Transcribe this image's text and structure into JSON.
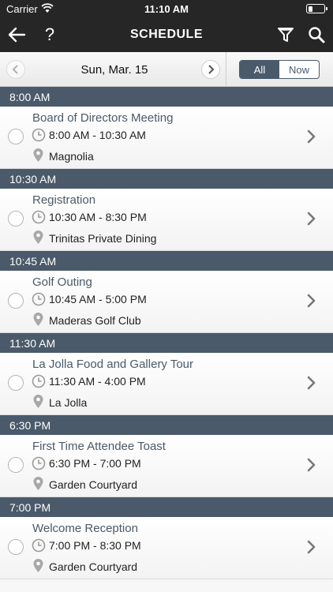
{
  "status_bar": {
    "carrier": "Carrier",
    "time": "11:10 AM"
  },
  "nav": {
    "title": "SCHEDULE",
    "help_label": "?"
  },
  "date_bar": {
    "date": "Sun, Mar. 15",
    "segments": [
      "All",
      "Now"
    ],
    "selected_segment": "All"
  },
  "colors": {
    "header_bg": "#262626",
    "section_bg": "#4a5a6a",
    "accent": "#4a5a6a"
  },
  "sections": [
    {
      "time": "8:00 AM",
      "event": {
        "title": "Board of Directors Meeting",
        "time_range": "8:00 AM - 10:30 AM",
        "location": "Magnolia"
      }
    },
    {
      "time": "10:30 AM",
      "event": {
        "title": "Registration",
        "time_range": "10:30 AM - 8:30 PM",
        "location": "Trinitas Private Dining"
      }
    },
    {
      "time": "10:45 AM",
      "event": {
        "title": "Golf Outing",
        "time_range": "10:45 AM - 5:00 PM",
        "location": "Maderas Golf Club"
      }
    },
    {
      "time": "11:30 AM",
      "event": {
        "title": "La Jolla Food and Gallery Tour",
        "time_range": "11:30 AM - 4:00 PM",
        "location": "La Jolla"
      }
    },
    {
      "time": "6:30 PM",
      "event": {
        "title": "First Time Attendee Toast",
        "time_range": "6:30 PM - 7:00 PM",
        "location": "Garden Courtyard"
      }
    },
    {
      "time": "7:00 PM",
      "event": {
        "title": "Welcome Reception",
        "time_range": "7:00 PM - 8:30 PM",
        "location": "Garden Courtyard"
      }
    }
  ]
}
